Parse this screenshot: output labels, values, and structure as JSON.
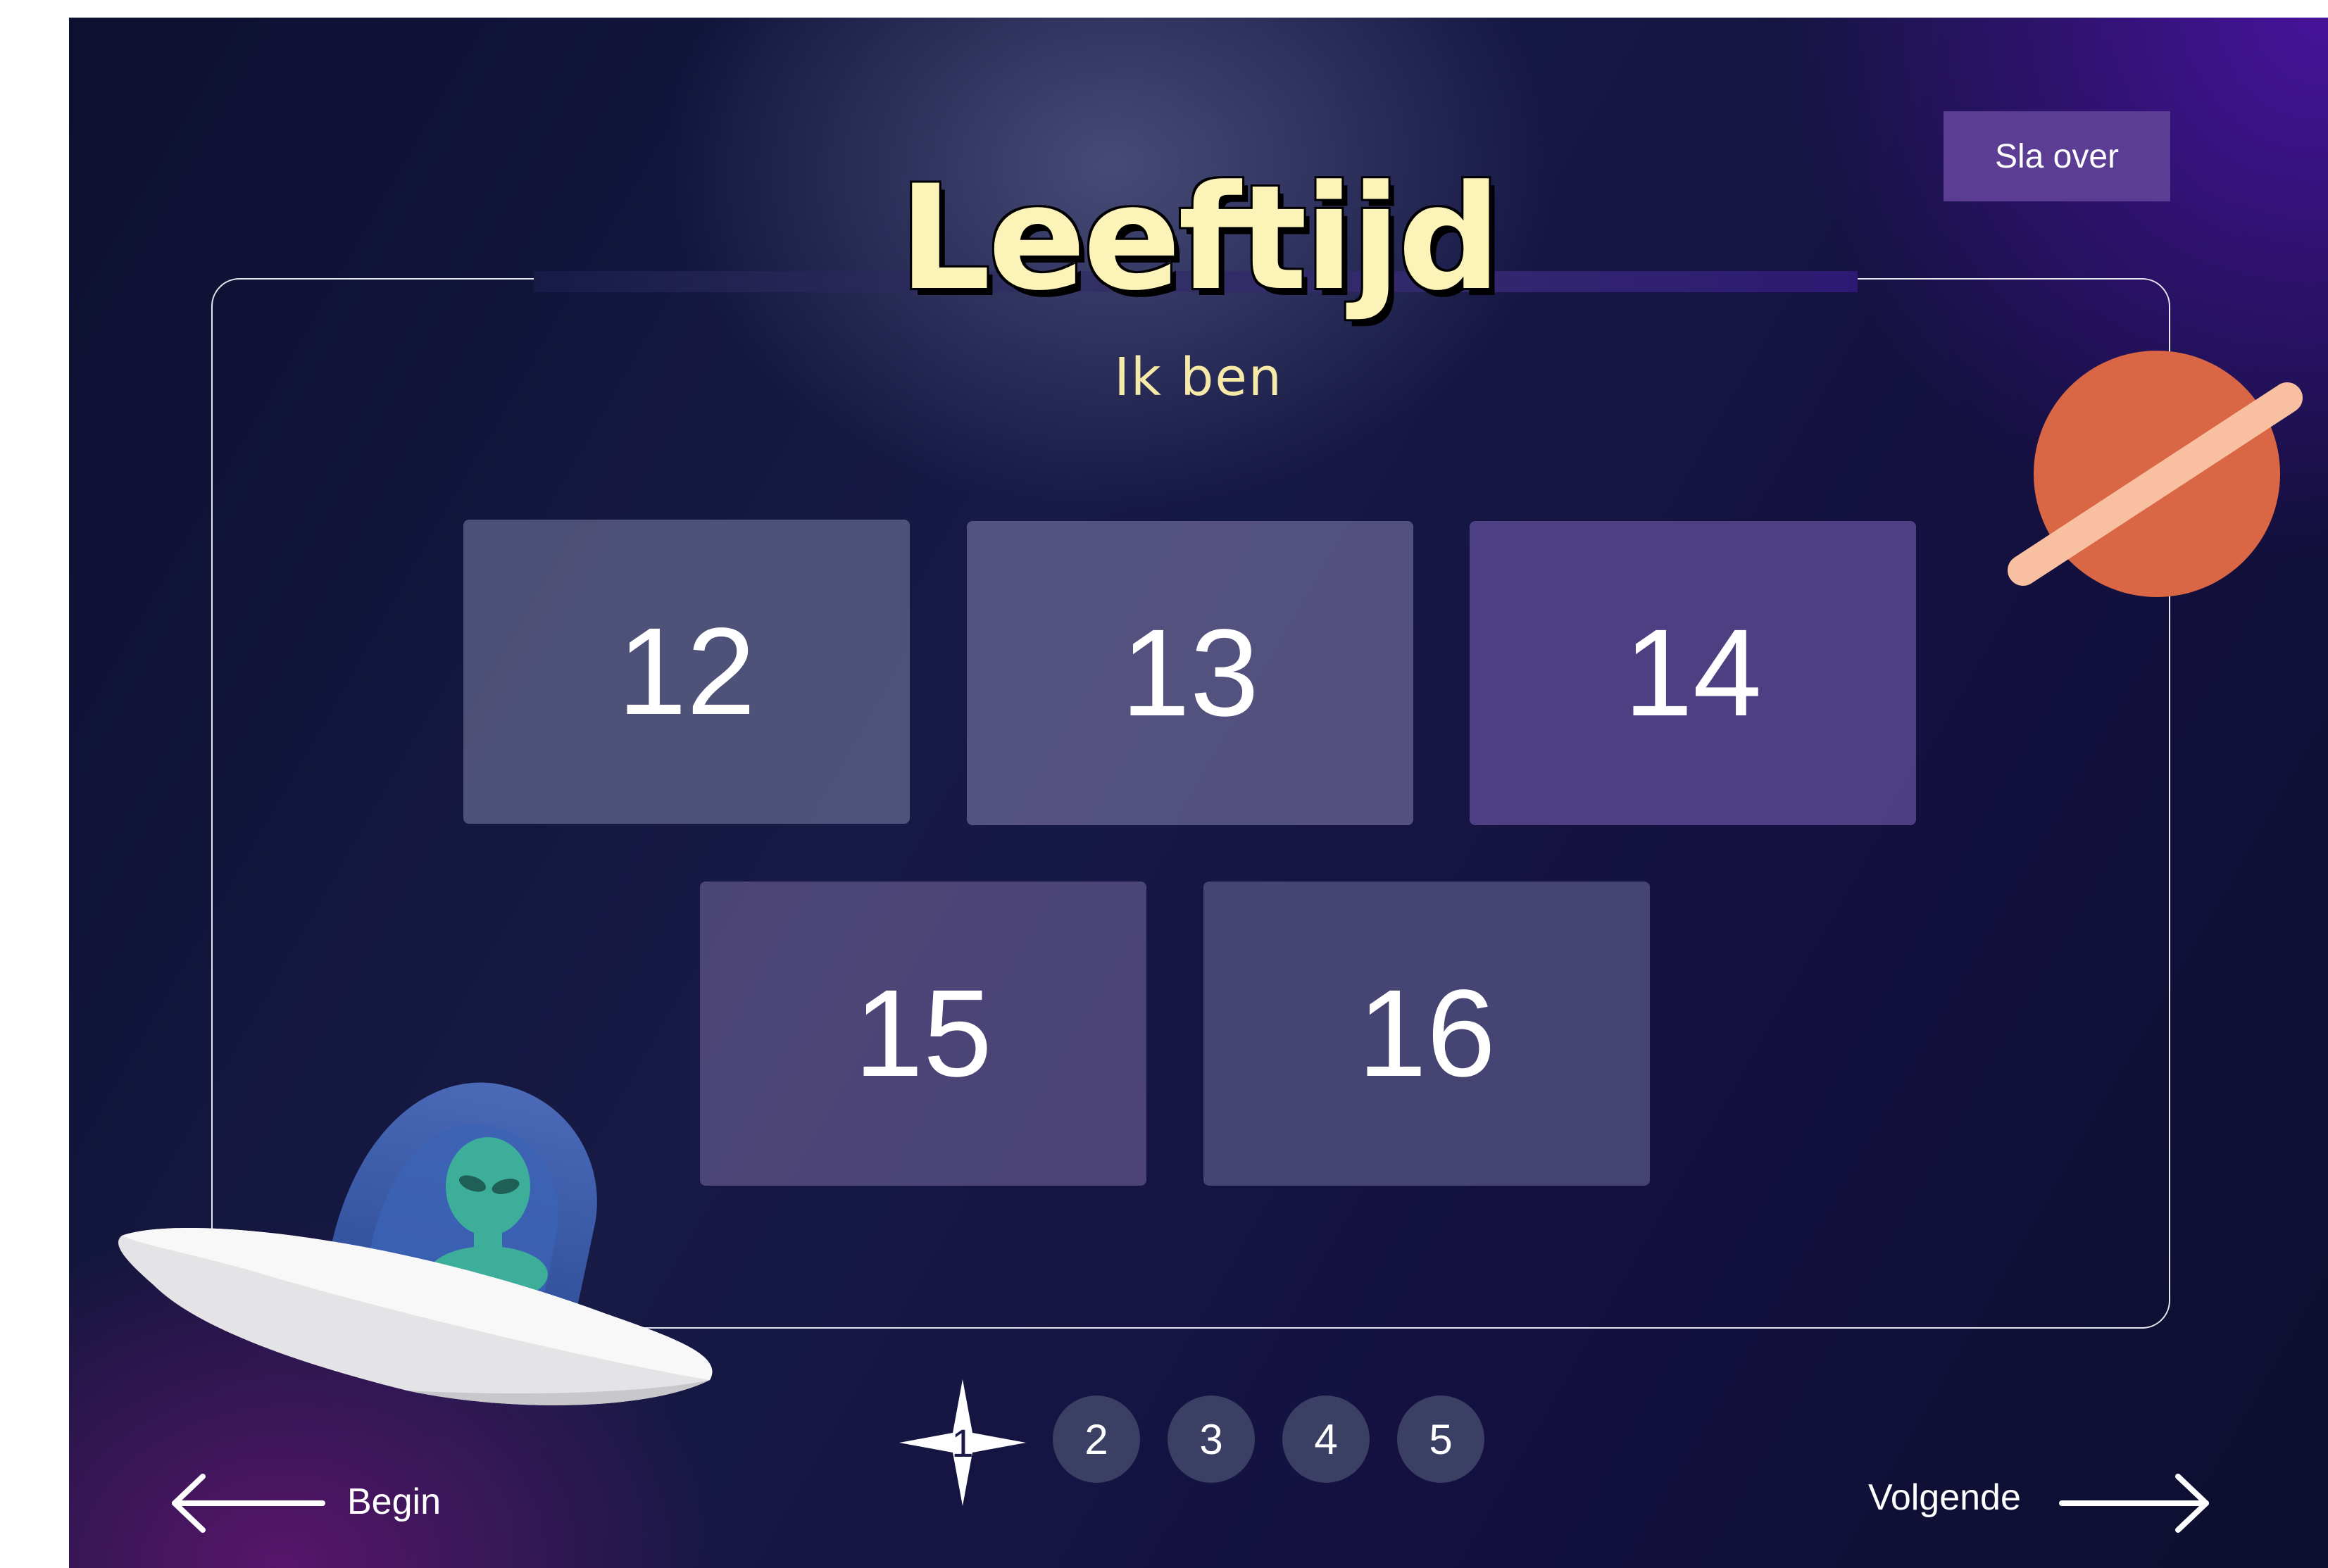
{
  "header": {
    "title": "Leeftijd",
    "subtitle": "Ik ben",
    "skip_label": "Sla over"
  },
  "ages": [
    "12",
    "13",
    "14",
    "15",
    "16"
  ],
  "pagination": {
    "current": "1",
    "steps": [
      "2",
      "3",
      "4",
      "5"
    ]
  },
  "nav": {
    "back_label": "Begin",
    "next_label": "Volgende"
  },
  "colors": {
    "title": "#fbf3b8",
    "skip_button": "#5b3e93",
    "planet": "#d96644",
    "planet_ring": "#f8c0a0",
    "alien": "#3cae9a"
  },
  "icons": {
    "planet": "planet-icon",
    "ufo": "ufo-icon",
    "current_step": "star-icon",
    "back": "arrow-left-icon",
    "next": "arrow-right-icon"
  }
}
